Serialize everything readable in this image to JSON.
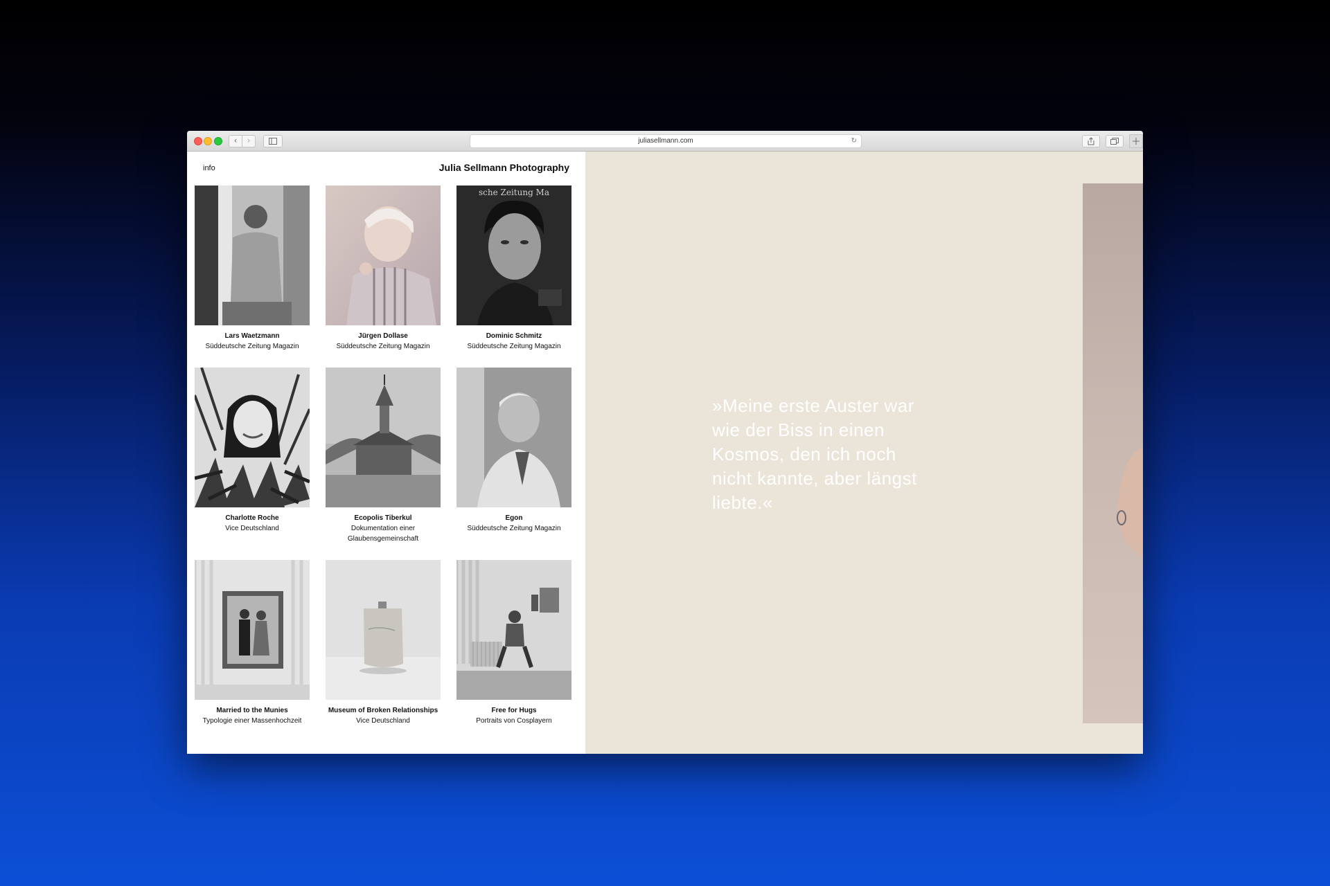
{
  "browser": {
    "url": "juliasellmann.com",
    "back_icon": "‹",
    "forward_icon": "›",
    "reload_icon": "↻"
  },
  "page": {
    "nav_info": "info",
    "site_title": "Julia Sellmann Photography"
  },
  "projects": [
    {
      "title": "Lars Waetzmann",
      "subtitle": "Süddeutsche Zeitung Magazin",
      "image": "bw-portrait-man-window"
    },
    {
      "title": "Jürgen Dollase",
      "subtitle": "Süddeutsche Zeitung Magazin",
      "image": "portrait-man-pastel"
    },
    {
      "title": "Dominic Schmitz",
      "subtitle": "Süddeutsche Zeitung Magazin",
      "image": "magazine-cover-portrait"
    },
    {
      "title": "Charlotte Roche",
      "subtitle": "Vice Deutschland",
      "image": "bw-woman-plants"
    },
    {
      "title": "Ecopolis Tiberkul",
      "subtitle": "Dokumentation einer Glaubensgemeinschaft",
      "image": "bw-wooden-church"
    },
    {
      "title": "Egon",
      "subtitle": "Süddeutsche Zeitung Magazin",
      "image": "bw-old-man"
    },
    {
      "title": "Married to the Munies",
      "subtitle": "Typologie einer Massenhochzeit",
      "image": "bw-framed-couple"
    },
    {
      "title": "Museum of Broken Relationships",
      "subtitle": "Vice Deutschland",
      "image": "bw-flask"
    },
    {
      "title": "Free for Hugs",
      "subtitle": "Portraits von Cosplayern",
      "image": "bw-cosplayer-room"
    }
  ],
  "cover_text": "sche Zeitung Ma",
  "quote": "»Meine erste Auster war wie der Biss in einen Kosmos, den ich noch nicht kannte, aber längst liebte.«",
  "colors": {
    "right_panel_bg": "#ebe4d8",
    "quote_text": "#ffffff",
    "background_gradient_top": "#000000",
    "background_gradient_bottom": "#0c4fd6"
  }
}
